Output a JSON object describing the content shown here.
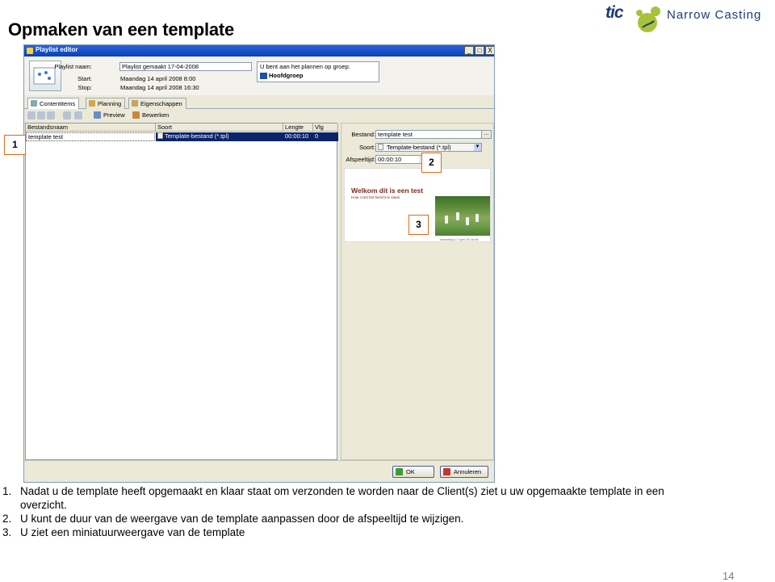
{
  "slide": {
    "title": "Opmaken van een template",
    "page_number": "14",
    "logo": {
      "mark": "tic",
      "text": "Narrow Casting"
    }
  },
  "window": {
    "title": "Playlist editor",
    "buttons": [
      "_",
      "□",
      "X"
    ],
    "header": {
      "playlist_name_label": "Playlist naam:",
      "playlist_name_value": "Playlist gemaakt 17-04-2008",
      "start_label": "Start:",
      "start_value": "Maandag 14 april 2008 8:00",
      "stop_label": "Stop:",
      "stop_value": "Maandag 14 april 2008 16:30",
      "planning_group_label": "U bent aan het plannen op groep:",
      "planning_group_value": "Hoofdgroep"
    },
    "tabs": [
      {
        "label": "Contentitems",
        "active": true
      },
      {
        "label": "Planning",
        "active": false
      },
      {
        "label": "Eigenschappen",
        "active": false
      }
    ],
    "toolbar": {
      "preview_label": "Preview",
      "edit_label": "Bewerken"
    },
    "list": {
      "columns": [
        "Bestandsnaam",
        "Soort",
        "Lengte",
        "Vlg"
      ],
      "rows": [
        {
          "name": "template test",
          "type": "Template-bestand (*.tpl)",
          "length": "00:00:10",
          "order": "0"
        }
      ]
    },
    "details": {
      "file_label": "Bestand:",
      "file_value": "template test",
      "file_button": "...",
      "type_label": "Soort:",
      "type_value": "Template-bestand (*.tpl)",
      "duration_label": "Afspeeltijd:",
      "duration_value": "00:00:10",
      "preview": {
        "title": "Welkom dit is een test",
        "subtitle": "Hoar comt het bericht te staan",
        "footer": "maandag 17 april    15:16:46"
      }
    },
    "footer": {
      "ok_label": "OK",
      "cancel_label": "Annuleren"
    }
  },
  "markers": [
    "1",
    "2",
    "3"
  ],
  "notes": [
    {
      "num": "1.",
      "text": "Nadat u de template heeft opgemaakt en klaar staat om verzonden te worden naar de Client(s) ziet u uw opgemaakte template in een"
    },
    {
      "num": "",
      "text": "overzicht."
    },
    {
      "num": "2.",
      "text": "U kunt de duur van de weergave van de template aanpassen door de afspeeltijd te wijzigen."
    },
    {
      "num": "3.",
      "text": "U ziet een miniatuurweergave van de template"
    }
  ],
  "colors": {
    "title_bar": "#0a3fb8",
    "selection": "#0a246a",
    "marker_border": "#d96c1c",
    "logo_blue": "#1d3b73",
    "logo_green": "#a8c23a"
  }
}
